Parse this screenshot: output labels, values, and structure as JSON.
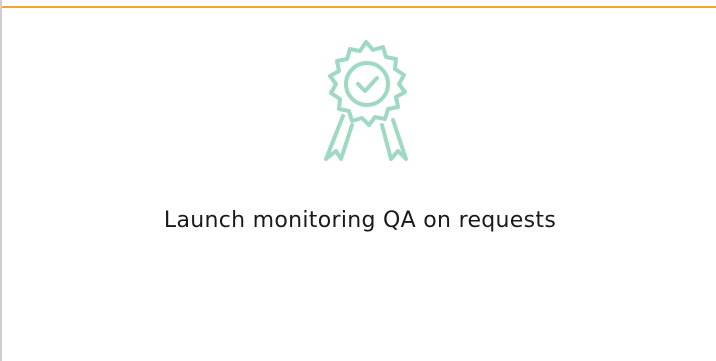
{
  "card": {
    "icon": "award-ribbon-check-icon",
    "title": "Launch monitoring QA on requests"
  },
  "colors": {
    "accent_border": "#f5a623",
    "icon_color": "#9fd9c4",
    "text": "#1a1a1a"
  }
}
